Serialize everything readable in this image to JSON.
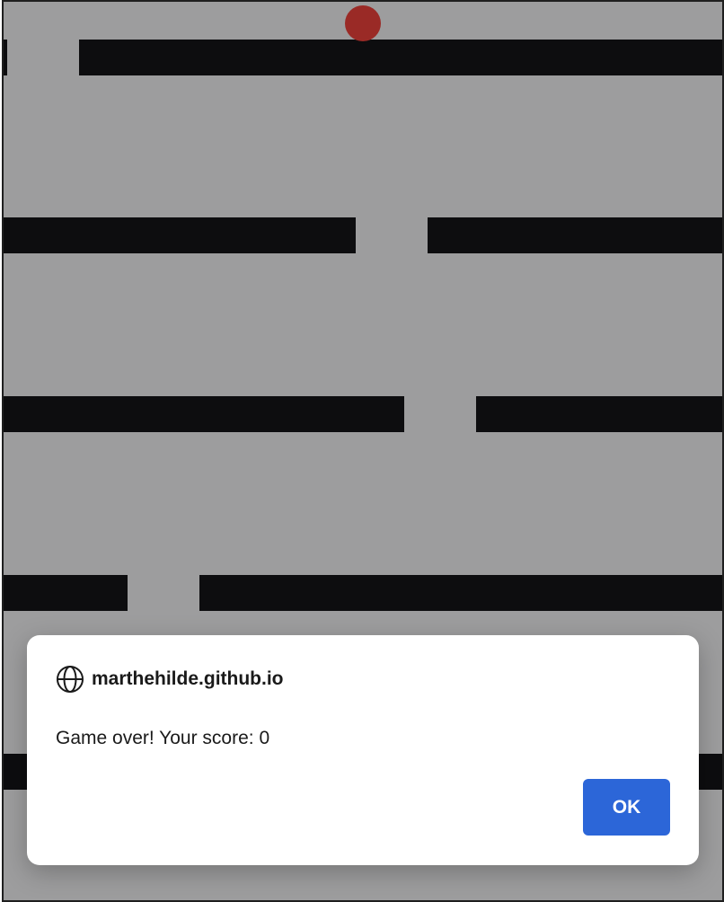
{
  "dialog": {
    "origin": "marthehilde.github.io",
    "message": "Game over! Your score: 0",
    "ok_label": "OK",
    "icon": "globe-icon"
  },
  "game": {
    "score": 0,
    "colors": {
      "background": "#9d9d9e",
      "bars": "#0d0d0f",
      "ball": "#9a2a26",
      "button": "#2c66d8"
    }
  }
}
